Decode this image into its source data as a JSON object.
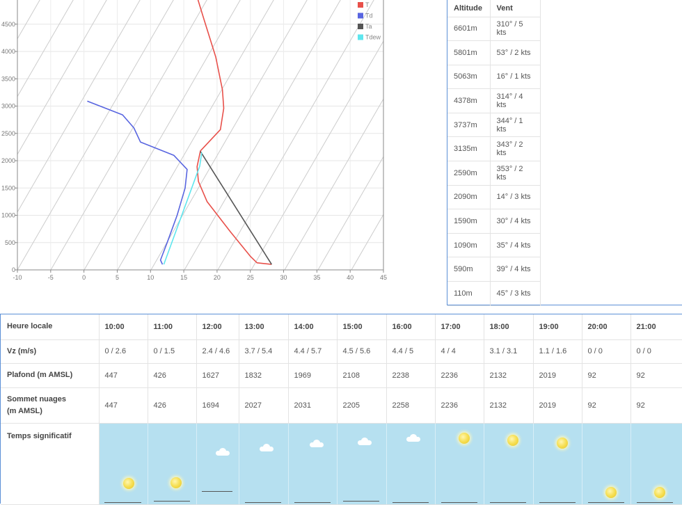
{
  "chart_data": {
    "type": "line",
    "title": "",
    "xlabel": "",
    "ylabel": "",
    "xlim": [
      -10,
      45
    ],
    "ylim": [
      0,
      5000
    ],
    "x_ticks": [
      "-10",
      "-5",
      "0",
      "5",
      "10",
      "15",
      "20",
      "25",
      "30",
      "35",
      "40",
      "45"
    ],
    "y_ticks": [
      "0",
      "500",
      "1000",
      "1500",
      "2000",
      "2500",
      "3000",
      "3500",
      "4000",
      "4500"
    ],
    "grid": true,
    "legend_position": "top-right",
    "series": [
      {
        "name": "T",
        "color": "#e8504a",
        "points": [
          [
            28.2,
            100
          ],
          [
            26,
            130
          ],
          [
            25,
            250
          ],
          [
            22,
            700
          ],
          [
            18.5,
            1250
          ],
          [
            17.2,
            1620
          ],
          [
            17,
            1890
          ],
          [
            17.5,
            2180
          ],
          [
            20.5,
            2570
          ],
          [
            21,
            2960
          ],
          [
            20.8,
            3300
          ],
          [
            19.8,
            3900
          ],
          [
            18,
            4600
          ],
          [
            17,
            5000
          ]
        ]
      },
      {
        "name": "Td",
        "color": "#5865e0",
        "points": [
          [
            11.8,
            100
          ],
          [
            11.5,
            180
          ],
          [
            12.5,
            500
          ],
          [
            14,
            1000
          ],
          [
            15.2,
            1500
          ],
          [
            15.5,
            1840
          ],
          [
            13.5,
            2100
          ],
          [
            8.5,
            2340
          ],
          [
            7.5,
            2600
          ],
          [
            5.8,
            2840
          ],
          [
            0.5,
            3090
          ]
        ]
      },
      {
        "name": "Ta",
        "color": "#555555",
        "points": [
          [
            28.2,
            100
          ],
          [
            17.5,
            2170
          ]
        ]
      },
      {
        "name": "Tdew",
        "color": "#5ee6ee",
        "points": [
          [
            12,
            100
          ],
          [
            17.4,
            1900
          ],
          [
            17.7,
            2150
          ]
        ]
      }
    ]
  },
  "wind_table": {
    "headers": {
      "altitude": "Altitude",
      "wind": "Vent"
    },
    "rows": [
      {
        "altitude": "6601m",
        "wind": "310° / 5 kts"
      },
      {
        "altitude": "5801m",
        "wind": "53° / 2 kts"
      },
      {
        "altitude": "5063m",
        "wind": "16° / 1 kts"
      },
      {
        "altitude": "4378m",
        "wind": "314° / 4 kts"
      },
      {
        "altitude": "3737m",
        "wind": "344° / 1 kts"
      },
      {
        "altitude": "3135m",
        "wind": "343° / 2 kts"
      },
      {
        "altitude": "2590m",
        "wind": "353° / 2 kts"
      },
      {
        "altitude": "2090m",
        "wind": "14° / 3 kts"
      },
      {
        "altitude": "1590m",
        "wind": "30° / 4 kts"
      },
      {
        "altitude": "1090m",
        "wind": "35° / 4 kts"
      },
      {
        "altitude": "590m",
        "wind": "39° / 4 kts"
      },
      {
        "altitude": "110m",
        "wind": "45° / 3 kts"
      }
    ]
  },
  "forecast": {
    "labels": {
      "hour": "Heure locale",
      "vz": "Vz (m/s)",
      "ceiling": "Plafond (m AMSL)",
      "cloud_top_1": "Sommet nuages",
      "cloud_top_2": "(m AMSL)",
      "weather": "Temps significatif"
    },
    "hours": [
      "10:00",
      "11:00",
      "12:00",
      "13:00",
      "14:00",
      "15:00",
      "16:00",
      "17:00",
      "18:00",
      "19:00",
      "20:00",
      "21:00"
    ],
    "vz": [
      "0 / 2.6",
      "0 / 1.5",
      "2.4 / 4.6",
      "3.7 / 5.4",
      "4.4 / 5.7",
      "4.5 / 5.6",
      "4.4 / 5",
      "4 / 4",
      "3.1 / 3.1",
      "1.1 / 1.6",
      "0 / 0",
      "0 / 0"
    ],
    "ceiling": [
      "447",
      "426",
      "1627",
      "1832",
      "1969",
      "2108",
      "2238",
      "2236",
      "2132",
      "2019",
      "92",
      "92"
    ],
    "cloud_top": [
      "447",
      "426",
      "1694",
      "2027",
      "2031",
      "2205",
      "2258",
      "2236",
      "2132",
      "2019",
      "92",
      "92"
    ],
    "weather_icons": [
      "sun",
      "sun",
      "cloud",
      "cloud",
      "cloud",
      "cloud",
      "cloud",
      "sun",
      "sun",
      "sun",
      "sun",
      "sun"
    ],
    "sky_color": "#b6e0f0"
  }
}
